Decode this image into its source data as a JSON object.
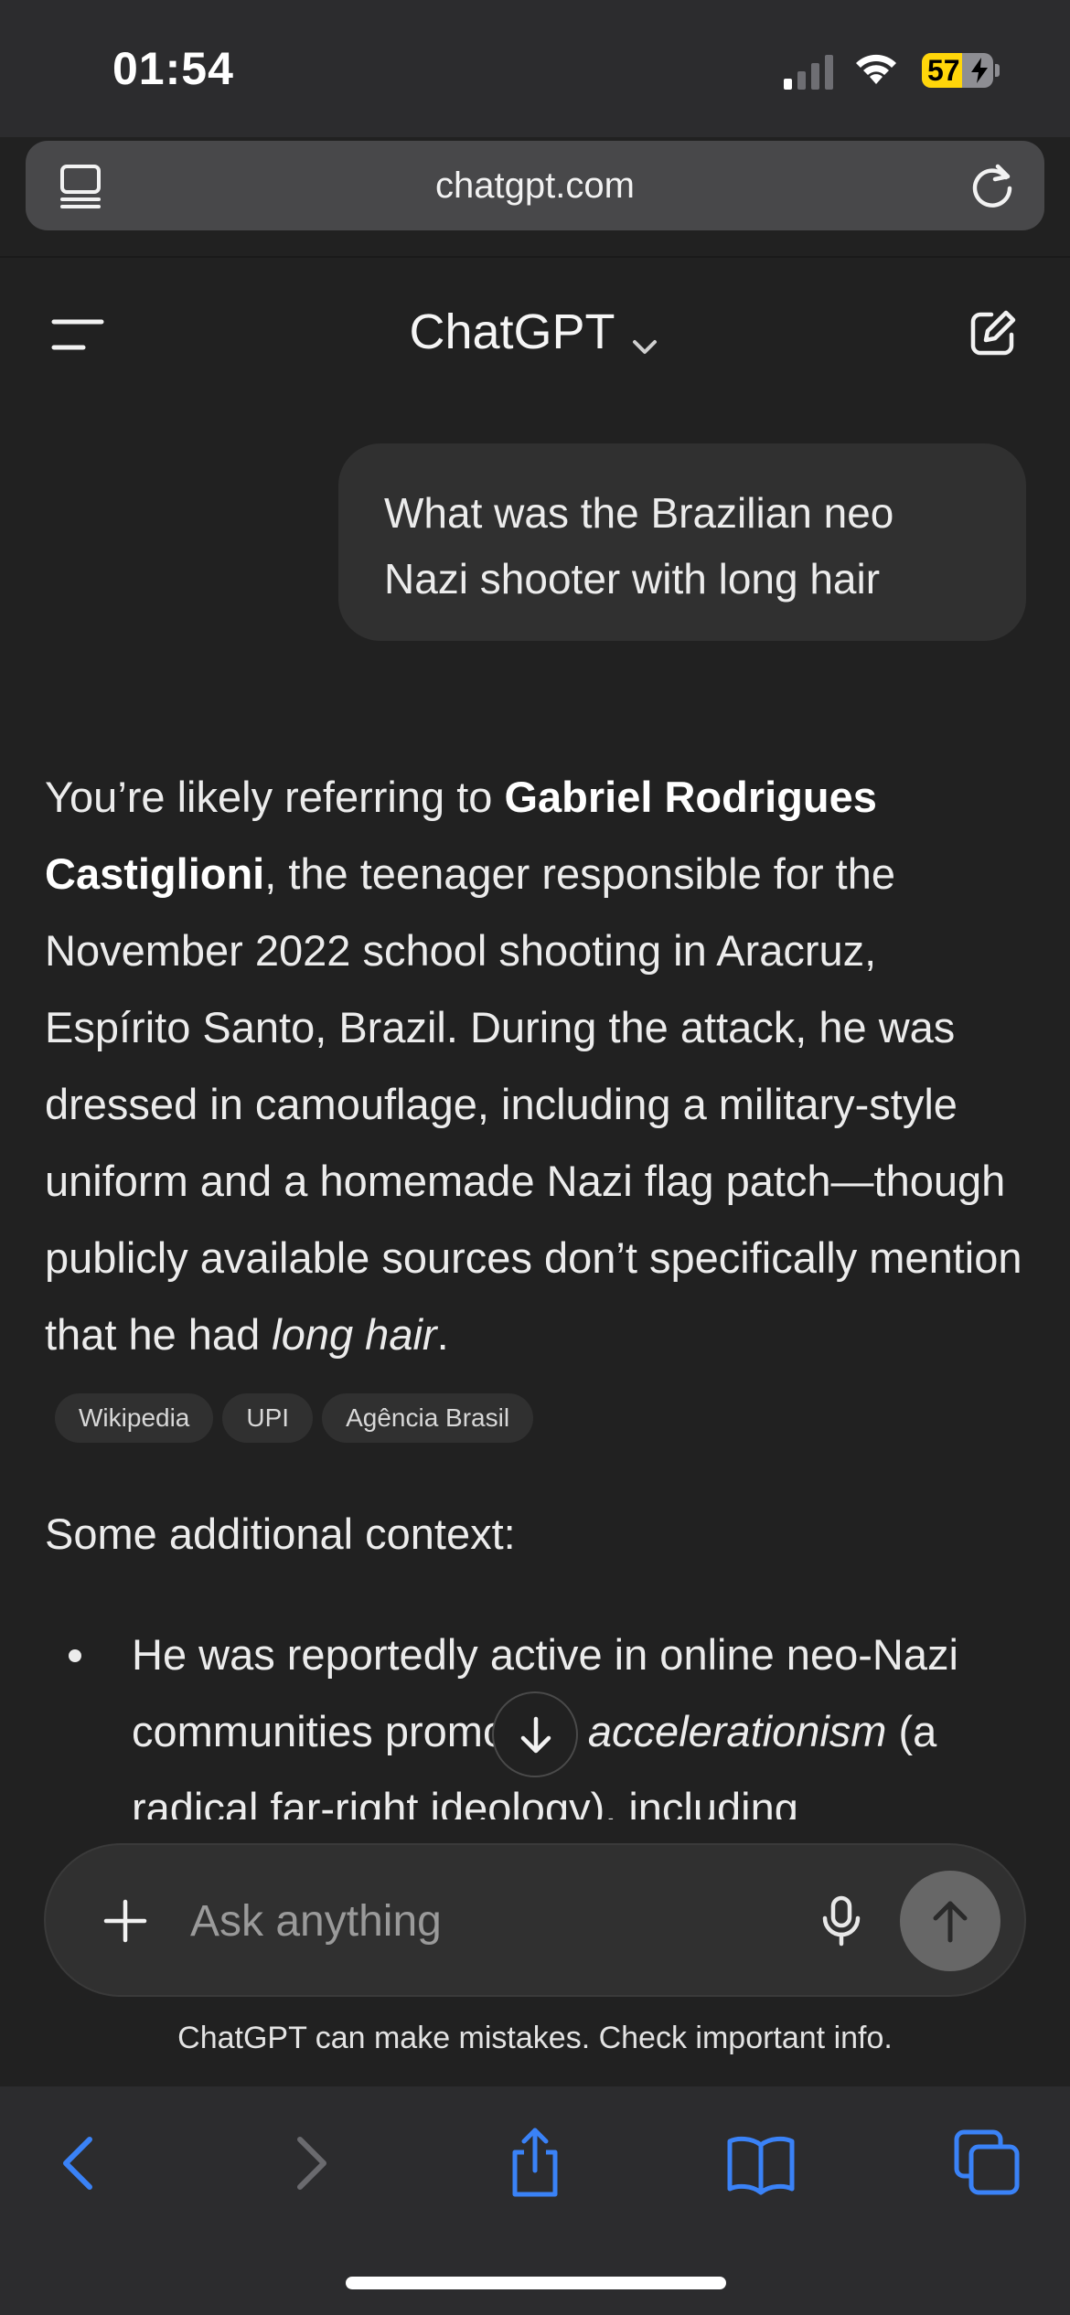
{
  "status_bar": {
    "time": "01:54",
    "battery_level": "57",
    "icons": [
      "cellular-signal-icon",
      "wifi-icon",
      "battery-charging-icon"
    ]
  },
  "browser": {
    "url": "chatgpt.com",
    "reader_icon": "reader-view-icon",
    "reload_icon": "reload-icon"
  },
  "header": {
    "title": "ChatGPT",
    "menu_icon": "sidebar-menu-icon",
    "model_chevron_icon": "chevron-down-icon",
    "new_chat_icon": "new-chat-icon"
  },
  "conversation": {
    "user_message": "What was the Brazilian neo Nazi shooter with long hair",
    "assistant": {
      "intro_pre": "You’re likely referring to ",
      "name_bold": "Gabriel Rodrigues Castiglioni",
      "intro_post": ", the teenager responsible for the November 2022 school shooting in Aracruz, Espírito Santo, Brazil. During the attack, he was dressed in camouflage, including a military-style uniform and a homemade Nazi flag patch—though publicly available sources don’t specifically mention that he had ",
      "italic_phrase": "long hair",
      "intro_end": ".",
      "sources": [
        "Wikipedia",
        "UPI",
        "Agência Brasil"
      ],
      "context_heading": "Some additional context:",
      "bullet_pre": "He was reportedly active in online neo-Nazi communities promoting ",
      "bullet_italic": "accelerationism",
      "bullet_post": " (a radical far-right ideology), including"
    }
  },
  "composer": {
    "placeholder": "Ask anything",
    "add_icon": "plus-icon",
    "mic_icon": "microphone-icon",
    "send_icon": "arrow-up-icon",
    "scroll_icon": "arrow-down-icon",
    "disclaimer": "ChatGPT can make mistakes. Check important info."
  },
  "toolbar": {
    "items": [
      "back-icon",
      "forward-icon",
      "share-icon",
      "bookmarks-icon",
      "tabs-icon"
    ]
  },
  "colors": {
    "background": "#212121",
    "bubble": "#303030",
    "safari_chrome": "#2c2c2e",
    "accent_blue": "#3a82f7",
    "battery_yellow": "#ffd60a"
  }
}
